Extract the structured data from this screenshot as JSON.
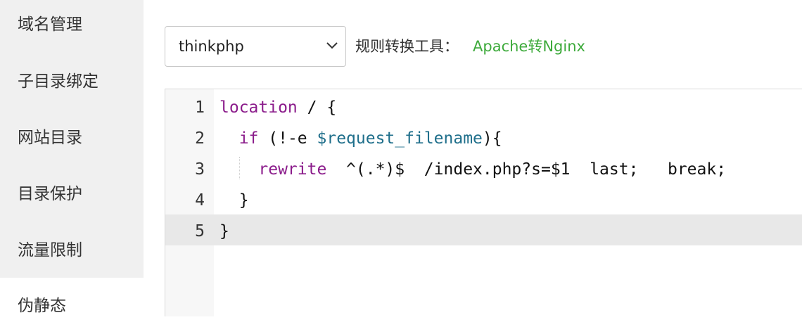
{
  "sidebar": {
    "items": [
      {
        "label": "域名管理"
      },
      {
        "label": "子目录绑定"
      },
      {
        "label": "网站目录"
      },
      {
        "label": "目录保护"
      },
      {
        "label": "流量限制"
      },
      {
        "label": "伪静态"
      }
    ]
  },
  "template_select": {
    "value": "thinkphp"
  },
  "rule_tool": {
    "label": "规则转换工具：",
    "link": "Apache转Nginx"
  },
  "editor": {
    "active_line": 5,
    "lines": [
      {
        "num": "1",
        "kw": "location",
        "rest": " / {"
      },
      {
        "num": "2",
        "pre": "  ",
        "kw": "if",
        "mid": " (!-e ",
        "var": "$request_filename",
        "rest": "){"
      },
      {
        "num": "3",
        "pre": "    ",
        "kw": "rewrite",
        "rest": "  ^(.*)$  /index.php?s=$1  last;   break;"
      },
      {
        "num": "4",
        "rest": "  }"
      },
      {
        "num": "5",
        "rest": "}"
      }
    ]
  },
  "colors": {
    "link": "#3daa3b",
    "keyword": "#8b1c8b",
    "variable": "#1f6f8b"
  }
}
